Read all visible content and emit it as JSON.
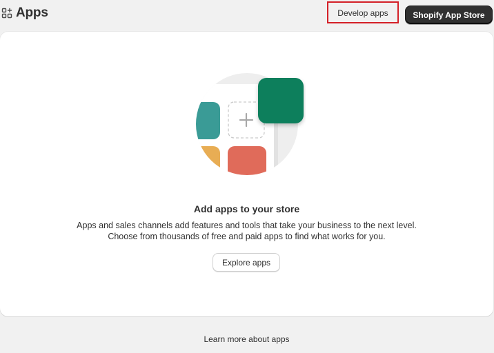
{
  "header": {
    "icon": "apps-grid-icon",
    "title": "Apps",
    "develop_apps_label": "Develop apps",
    "app_store_label": "Shopify App Store"
  },
  "highlight": {
    "target": "develop-apps-button",
    "color": "#d41f27"
  },
  "empty_state": {
    "illustration": "add-apps-illustration",
    "heading": "Add apps to your store",
    "description_line1": "Apps and sales channels add features and tools that take your business to the next level.",
    "description_line2": "Choose from thousands of free and paid apps to find what works for you.",
    "explore_label": "Explore apps"
  },
  "footer": {
    "learn_more_label": "Learn more about apps"
  },
  "colors": {
    "background": "#f1f1f1",
    "card": "#ffffff",
    "primary_button": "#303030",
    "tile_teal": "#3a9b96",
    "tile_green": "#0f7f5b",
    "tile_orange": "#e8ad54",
    "tile_red": "#e06b5a"
  }
}
